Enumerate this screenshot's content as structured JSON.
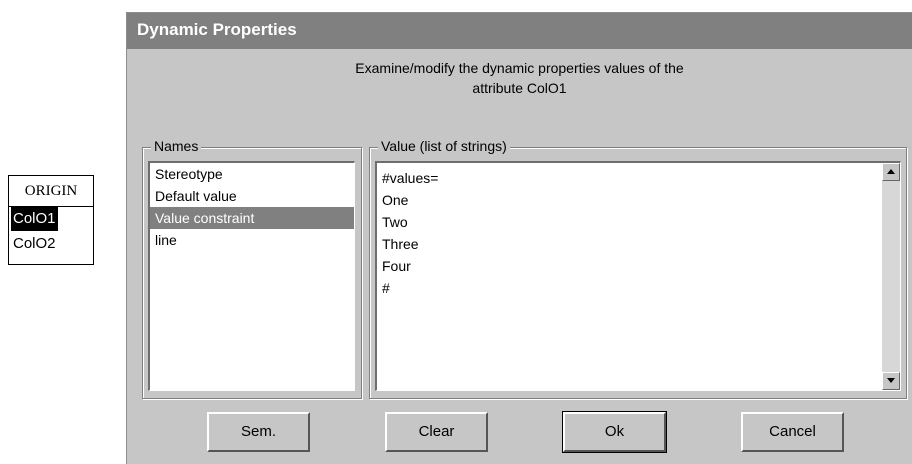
{
  "entity": {
    "title": "ORIGIN",
    "attributes": [
      "ColO1",
      "ColO2"
    ],
    "selected_index": 0
  },
  "dialog": {
    "title": "Dynamic Properties",
    "description_line1": "Examine/modify the dynamic properties values of the",
    "description_line2": "attribute ColO1",
    "names_label": "Names",
    "names": [
      "Stereotype",
      "Default value",
      "Value constraint",
      "line"
    ],
    "selected_name_index": 2,
    "value_label": "Value (list of strings)",
    "values": [
      "#values=",
      "One",
      "Two",
      "Three",
      "Four",
      "#"
    ],
    "buttons": {
      "sem": "Sem.",
      "clear": "Clear",
      "ok": "Ok",
      "cancel": "Cancel"
    }
  }
}
